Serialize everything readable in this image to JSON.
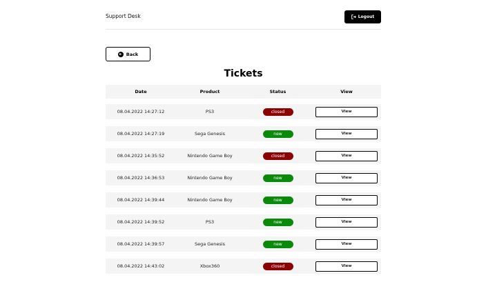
{
  "header": {
    "brand": "Support Desk",
    "logout_label": "Logout"
  },
  "back_label": "Back",
  "page_title": "Tickets",
  "table": {
    "columns": [
      "Date",
      "Product",
      "Status",
      "View"
    ],
    "rows": [
      {
        "date": "08.04.2022 14:27:12",
        "product": "PS3",
        "status": "closed",
        "action": "View"
      },
      {
        "date": "08.04.2022 14:27:19",
        "product": "Sega Genesis",
        "status": "new",
        "action": "View"
      },
      {
        "date": "08.04.2022 14:35:52",
        "product": "Nintendo Game Boy",
        "status": "closed",
        "action": "View"
      },
      {
        "date": "08.04.2022 14:36:53",
        "product": "Nintendo Game Boy",
        "status": "new",
        "action": "View"
      },
      {
        "date": "08.04.2022 14:39:44",
        "product": "Nintendo Game Boy",
        "status": "new",
        "action": "View"
      },
      {
        "date": "08.04.2022 14:39:52",
        "product": "PS3",
        "status": "new",
        "action": "View"
      },
      {
        "date": "08.04.2022 14:39:57",
        "product": "Sega Genesis",
        "status": "new",
        "action": "View"
      },
      {
        "date": "08.04.2022 14:43:02",
        "product": "Xbox360",
        "status": "closed",
        "action": "View"
      }
    ]
  },
  "colors": {
    "closed": "#8b0000",
    "new": "#0a8a0a",
    "row_bg": "#f4f4f4"
  }
}
